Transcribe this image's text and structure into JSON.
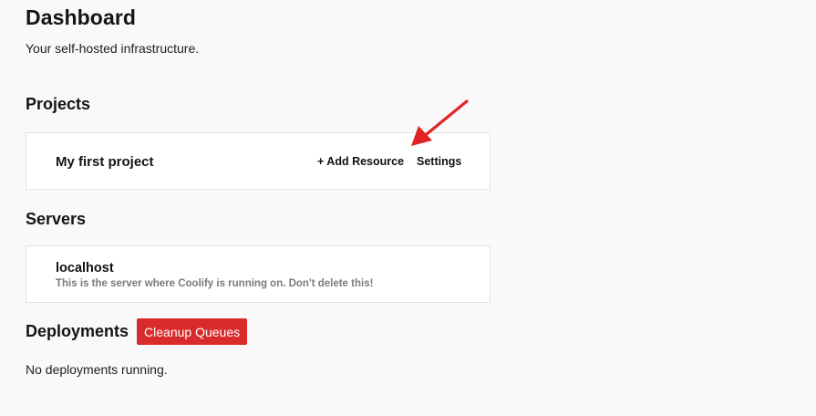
{
  "header": {
    "title": "Dashboard",
    "subtitle": "Your self-hosted infrastructure."
  },
  "projects": {
    "title": "Projects",
    "items": [
      {
        "name": "My first project",
        "add_resource_label": "+ Add Resource",
        "settings_label": "Settings"
      }
    ]
  },
  "servers": {
    "title": "Servers",
    "items": [
      {
        "name": "localhost",
        "description": "This is the server where Coolify is running on. Don't delete this!"
      }
    ]
  },
  "deployments": {
    "title": "Deployments",
    "cleanup_label": "Cleanup Queues",
    "empty_text": "No deployments running."
  },
  "colors": {
    "background": "#f9f9f9",
    "card": "#ffffff",
    "danger": "#d92b2b",
    "annotation": "#e02424",
    "muted_text": "#7a7a7a"
  }
}
